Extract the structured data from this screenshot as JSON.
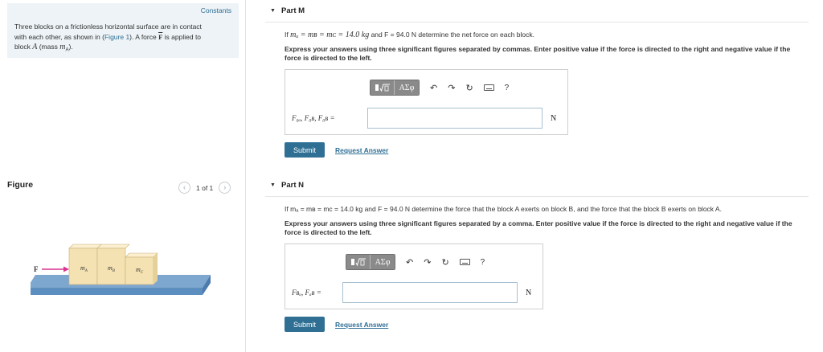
{
  "problem": {
    "constants_label": "Constants",
    "text_line1": "Three blocks on a frictionless horizontal surface are in contact",
    "text_line2_pre": "with each other, as shown in (",
    "figure_link": "Figure 1",
    "text_line2_post": "). A force",
    "force_symbol": "F",
    "text_line2_end": "is applied to",
    "text_line3_pre": "block",
    "block_a": "A",
    "text_line3_mid": "(mass",
    "mass_a": "m",
    "mass_a_sub": "A",
    "text_line3_end": ")."
  },
  "figure": {
    "title": "Figure",
    "pager_label": "1 of 1",
    "force_label": "F",
    "block_labels": [
      "m",
      "m",
      "m"
    ],
    "block_subs": [
      "A",
      "B",
      "C"
    ]
  },
  "colors": {
    "accent": "#2f6f94",
    "block_fill": "#f4e2b2",
    "surface": "#7da7cf",
    "force_arrow": "#d9358e"
  },
  "part_m": {
    "title": "Part M",
    "question_if": "If",
    "question_eq": "mₐ = mʙ = mᴄ = 14.0 kg",
    "question_mid": "and F = 94.0 N determine the net force on each block.",
    "instructions": "Express your answers using three significant figures separated by commas. Enter positive value if the force is directed to the right and negative value if the force is directed to the left.",
    "answer_label": "F₀ₐ, F₀ʙ, F₀ʙ =",
    "input_value": "",
    "unit": "N",
    "submit": "Submit",
    "request_answer": "Request Answer"
  },
  "part_n": {
    "title": "Part N",
    "question_if": "If",
    "question_rest": "mₐ = mʙ = mᴄ = 14.0 kg and F = 94.0 N determine the force that the block A exerts on block B, and the force that the block B exerts on block A.",
    "instructions": "Express your answers using three significant figures separated by a comma. Enter positive value if the force is directed to the right and negative value if the force is directed to the left.",
    "answer_label": "Fʙₐ, Fₐʙ =",
    "input_value": "",
    "unit": "N",
    "submit": "Submit",
    "request_answer": "Request Answer"
  },
  "toolbar": {
    "templates_icon": "sqrt-template-icon",
    "symbols_label": "ΑΣφ",
    "undo_icon": "↶",
    "redo_icon": "↷",
    "reset_icon": "↻",
    "keyboard_icon": "keyboard-icon",
    "help_label": "?"
  }
}
